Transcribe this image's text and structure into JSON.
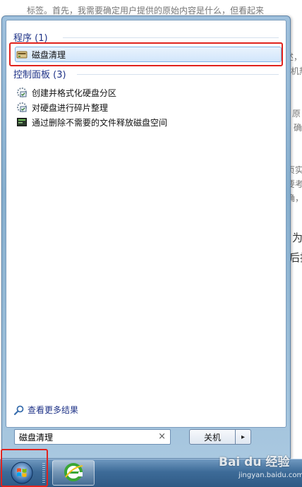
{
  "background": {
    "lines": [
      "标签。首先，我需要确定用户提供的原始内容是什么，但看起来",
      "述，",
      "机热",
      "原",
      "，确",
      "",
      "页实",
      "要考",
      "确，",
      "为",
      "后指"
    ]
  },
  "start_menu": {
    "programs_group": {
      "title": "程序 (1)",
      "items": [
        {
          "label": "磁盘清理",
          "icon": "disk-cleanup-icon"
        }
      ]
    },
    "control_panel_group": {
      "title": "控制面板 (3)",
      "items": [
        {
          "label": "创建并格式化硬盘分区",
          "icon": "disk-manage-icon"
        },
        {
          "label": "对硬盘进行碎片整理",
          "icon": "defrag-icon"
        },
        {
          "label": "通过删除不需要的文件释放磁盘空间",
          "icon": "free-space-icon"
        }
      ]
    },
    "see_more": {
      "label": "查看更多结果",
      "icon": "search-icon"
    },
    "search": {
      "value": "磁盘清理",
      "clear": "×"
    },
    "shutdown": {
      "label": "关机",
      "arrow": "▸"
    }
  },
  "watermark": {
    "brand": "Bai du 经验",
    "url": "jingyan.baidu.com"
  },
  "colors": {
    "accent_blue": "#1e3287",
    "highlight_red": "#e0231e",
    "taskbar": "#3d6b98"
  }
}
